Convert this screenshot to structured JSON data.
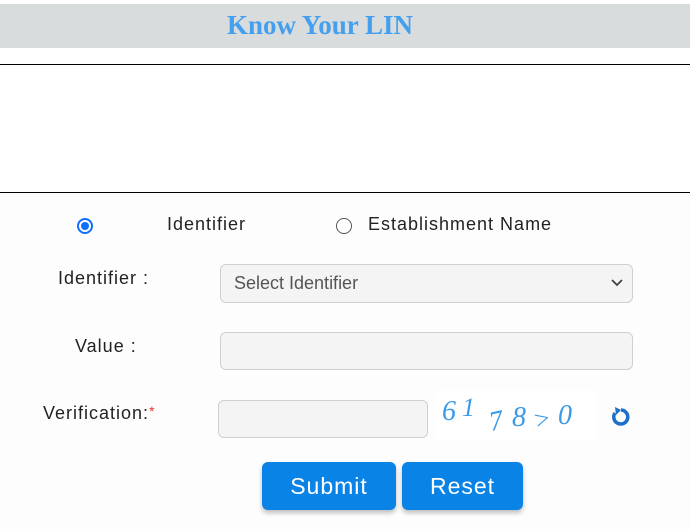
{
  "header": {
    "title": "Know Your LIN"
  },
  "search_type": {
    "options": [
      {
        "label": "Identifier",
        "selected": true
      },
      {
        "label": "Establishment Name",
        "selected": false
      }
    ]
  },
  "form": {
    "identifier": {
      "label": "Identifier :",
      "selected_value": "Select Identifier"
    },
    "value": {
      "label": "Value :",
      "value": "",
      "placeholder": ""
    },
    "verification": {
      "label": "Verification:",
      "required_marker": "*",
      "value": "",
      "captcha_text": "61 78>0"
    }
  },
  "buttons": {
    "submit": "Submit",
    "reset": "Reset"
  },
  "colors": {
    "title": "#44a0ee",
    "button": "#0a83e6",
    "radio": "#0d6efd",
    "captcha": "#3a9ae8",
    "required": "#e53935"
  },
  "icons": {
    "refresh": "refresh-icon",
    "dropdown": "chevron-down-icon"
  }
}
